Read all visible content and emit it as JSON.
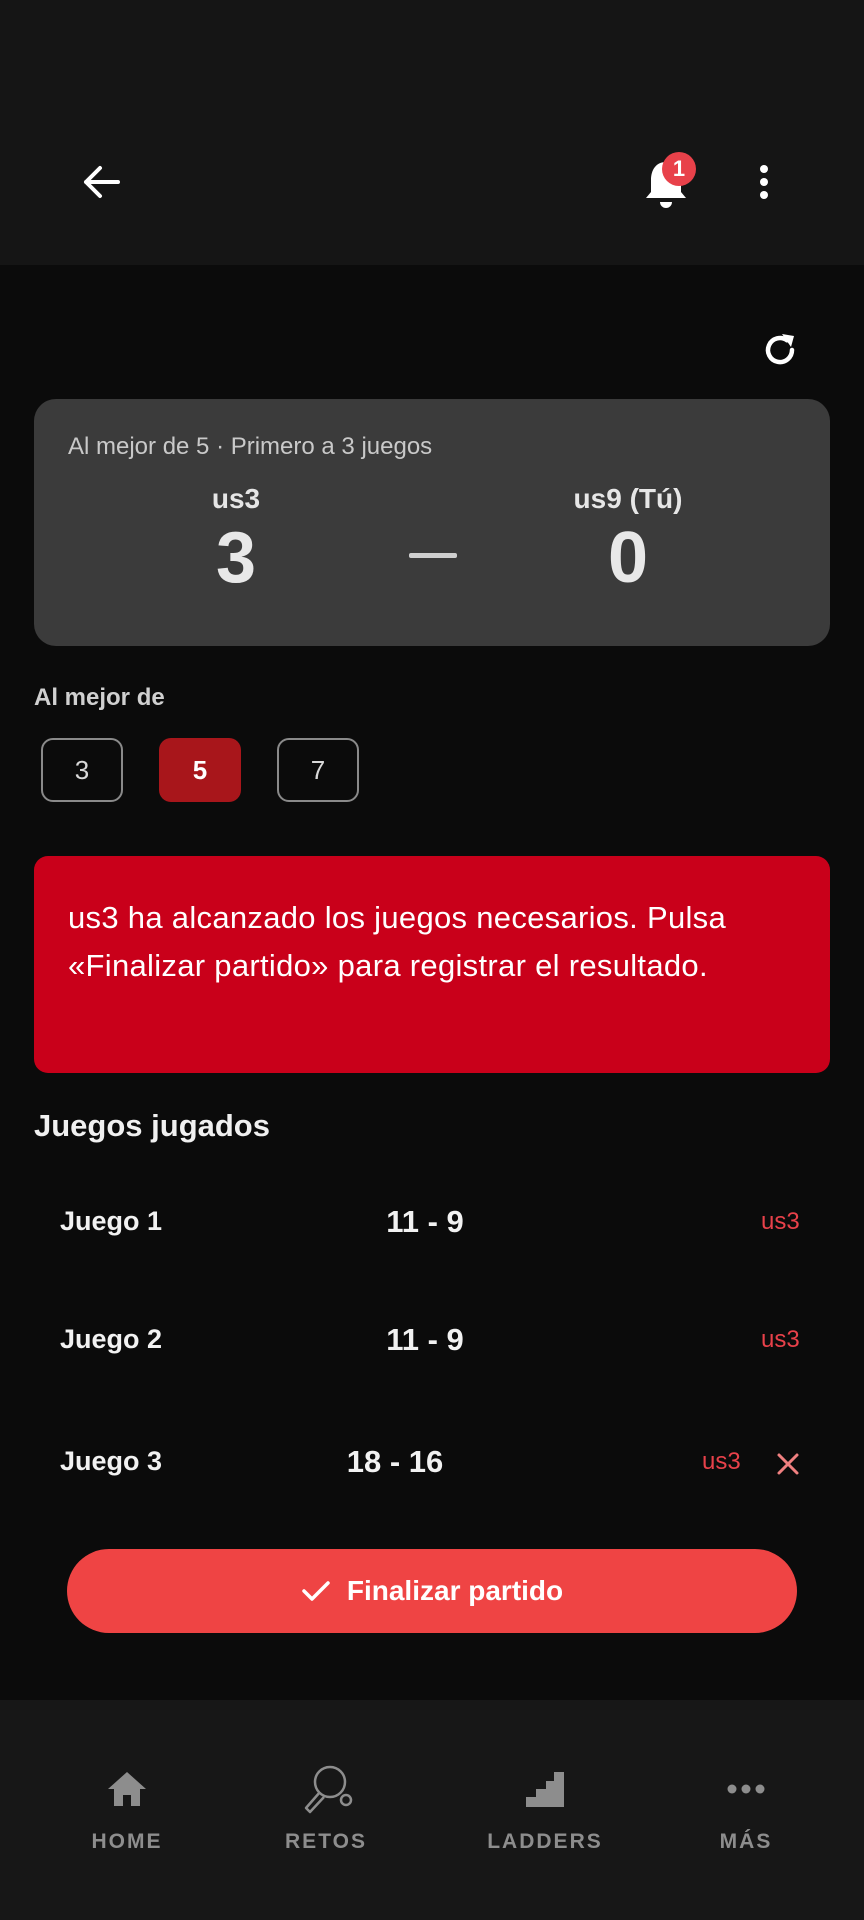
{
  "header": {
    "notification_count": "1"
  },
  "match": {
    "format_text": "Al mejor de 5 · Primero a 3 juegos",
    "player1": {
      "name": "us3",
      "score": "3"
    },
    "player2": {
      "name": "us9 (Tú)",
      "score": "0"
    }
  },
  "best_of": {
    "label": "Al mejor de",
    "options": [
      "3",
      "5",
      "7"
    ],
    "selected": "5"
  },
  "alert": {
    "text": "us3 ha alcanzado los juegos necesarios. Pulsa «Finalizar partido» para registrar el resultado."
  },
  "games": {
    "title": "Juegos jugados",
    "rows": [
      {
        "name": "Juego 1",
        "score": "11 - 9",
        "winner": "us3"
      },
      {
        "name": "Juego 2",
        "score": "11 - 9",
        "winner": "us3"
      },
      {
        "name": "Juego 3",
        "score": "18 - 16",
        "winner": "us3"
      }
    ]
  },
  "finish_button": {
    "label": "Finalizar partido"
  },
  "nav": {
    "items": [
      {
        "label": "HOME",
        "icon": "home-icon"
      },
      {
        "label": "RETOS",
        "icon": "paddle-icon"
      },
      {
        "label": "LADDERS",
        "icon": "stairs-icon"
      },
      {
        "label": "MÁS",
        "icon": "dots-icon"
      }
    ]
  },
  "colors": {
    "accent": "#ef4444",
    "alert_bg": "#c9001a",
    "selected_bg": "#a8161b",
    "card_bg": "#3b3b3b"
  }
}
